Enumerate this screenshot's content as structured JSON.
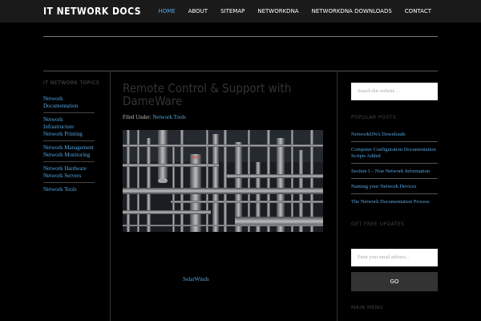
{
  "site": {
    "title": "IT NETWORK DOCS"
  },
  "nav": {
    "items": [
      {
        "label": "HOME"
      },
      {
        "label": "ABOUT"
      },
      {
        "label": "SITEMAP"
      },
      {
        "label": "NETWORKDNA"
      },
      {
        "label": "NETWORKDNA DOWNLOADS"
      },
      {
        "label": "CONTACT"
      }
    ]
  },
  "left_sidebar": {
    "title": "IT NETWORK TOPICS",
    "links": [
      {
        "label": "Network Documentation"
      },
      {
        "label": "Network Infrastructure Network Printing"
      },
      {
        "label": "Network Management Network Monitoring"
      },
      {
        "label": "Network Hardware Network Servers"
      },
      {
        "label": "Network Tools"
      }
    ]
  },
  "post": {
    "title": "Remote Control & Support with DameWare",
    "filed_prefix": "Filed Under:",
    "filed_category": "Network Tools",
    "link_text": "SolarWinds"
  },
  "right_sidebar": {
    "search_placeholder": "Search this website …",
    "popular_title": "POPULAR POSTS",
    "popular_links": [
      {
        "label": "NetworkDNA Downloads"
      },
      {
        "label": "Computer Configuration Documentation Scripts Added"
      },
      {
        "label": "Section I – Non Network Information"
      },
      {
        "label": "Naming your Network Devices"
      },
      {
        "label": "The Network Documentation Process"
      }
    ],
    "updates_title": "GET FREE UPDATES",
    "email_placeholder": "Enter your email address...",
    "go_label": "GO",
    "main_menu_title": "MAIN MENU"
  },
  "colors": {
    "accent": "#57a6e0",
    "background": "#000000",
    "topbar": "#1a1a1a"
  }
}
